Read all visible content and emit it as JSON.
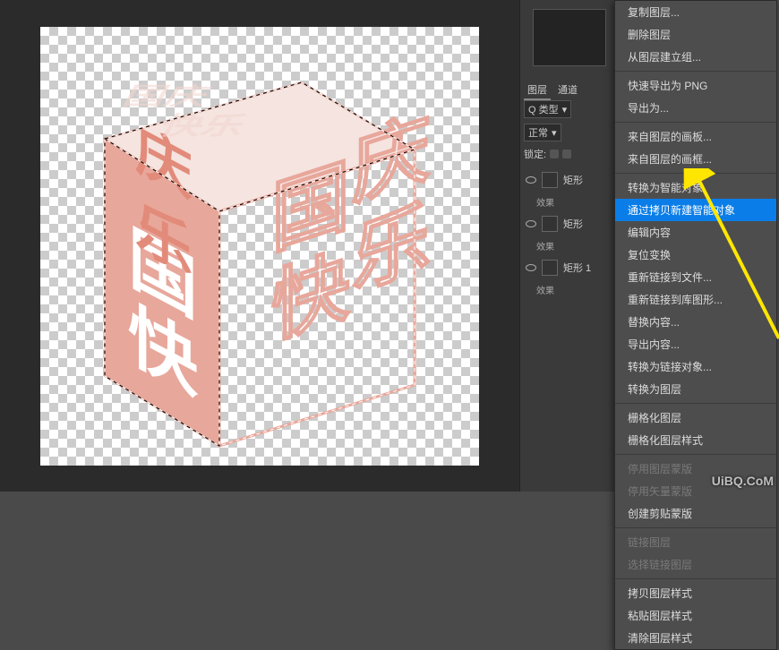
{
  "canvas": {
    "cube_chars": [
      "国",
      "庆",
      "快",
      "乐"
    ],
    "right_chars": [
      "国",
      "庆",
      "快",
      "乐"
    ],
    "face_fill": "#e8a79b",
    "outline_fill": "#ffffff"
  },
  "panel": {
    "tabs": [
      "图层",
      "通道"
    ],
    "search": {
      "label": "Q 类型"
    },
    "blend_mode": "正常",
    "lock_label": "锁定:",
    "layers": [
      {
        "name": "矩形",
        "effects": "效果"
      },
      {
        "name": "矩形",
        "effects": "效果"
      },
      {
        "name": "矩形 1",
        "effects": "效果"
      }
    ]
  },
  "menu": {
    "items": [
      {
        "label": "复制图层...",
        "disabled": false
      },
      {
        "label": "删除图层",
        "disabled": false
      },
      {
        "label": "从图层建立组...",
        "disabled": false
      },
      {
        "sep": true
      },
      {
        "label": "快速导出为 PNG",
        "disabled": false
      },
      {
        "label": "导出为...",
        "disabled": false
      },
      {
        "sep": true
      },
      {
        "label": "来自图层的画板...",
        "disabled": false
      },
      {
        "label": "来自图层的画框...",
        "disabled": false
      },
      {
        "sep": true
      },
      {
        "label": "转换为智能对象",
        "disabled": false
      },
      {
        "label": "通过拷贝新建智能对象",
        "disabled": false,
        "highlight": true
      },
      {
        "label": "编辑内容",
        "disabled": false
      },
      {
        "label": "复位变换",
        "disabled": false
      },
      {
        "label": "重新链接到文件...",
        "disabled": false
      },
      {
        "label": "重新链接到库图形...",
        "disabled": false
      },
      {
        "label": "替换内容...",
        "disabled": false
      },
      {
        "label": "导出内容...",
        "disabled": false
      },
      {
        "label": "转换为链接对象...",
        "disabled": false
      },
      {
        "label": "转换为图层",
        "disabled": false
      },
      {
        "sep": true
      },
      {
        "label": "栅格化图层",
        "disabled": false
      },
      {
        "label": "栅格化图层样式",
        "disabled": false
      },
      {
        "sep": true
      },
      {
        "label": "停用图层蒙版",
        "disabled": true
      },
      {
        "label": "停用矢量蒙版",
        "disabled": true
      },
      {
        "label": "创建剪贴蒙版",
        "disabled": false
      },
      {
        "sep": true
      },
      {
        "label": "链接图层",
        "disabled": true
      },
      {
        "label": "选择链接图层",
        "disabled": true
      },
      {
        "sep": true
      },
      {
        "label": "拷贝图层样式",
        "disabled": false
      },
      {
        "label": "粘贴图层样式",
        "disabled": false
      },
      {
        "label": "清除图层样式",
        "disabled": false
      }
    ]
  },
  "watermark": "UiBQ.CoM"
}
